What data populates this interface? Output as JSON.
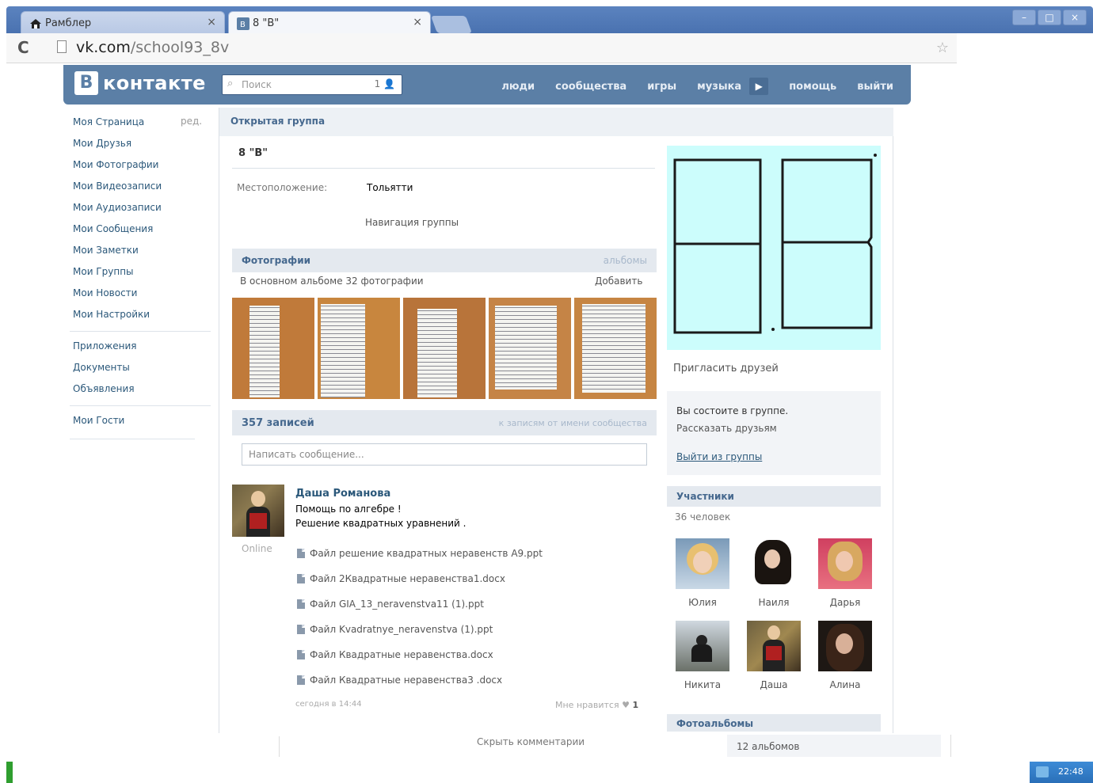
{
  "browser": {
    "tabs": [
      {
        "label": "Рамблер",
        "close": "×"
      },
      {
        "label": "8 \"В\"",
        "close": "×"
      }
    ],
    "window_controls": [
      "–",
      "□",
      "×"
    ],
    "url_host": "vk.com",
    "url_path": "/school93_8v"
  },
  "vk": {
    "logo_letter": "В",
    "logo_text": "контакте",
    "search_placeholder": "Поиск",
    "search_count": "1",
    "nav": [
      "люди",
      "сообщества",
      "игры",
      "музыка",
      "помощь",
      "выйти"
    ]
  },
  "left_menu": {
    "edit_label": "ред.",
    "items": [
      "Моя Страница",
      "Мои Друзья",
      "Мои Фотографии",
      "Мои Видеозаписи",
      "Мои Аудиозаписи",
      "Мои Сообщения",
      "Мои Заметки",
      "Мои Группы",
      "Мои Новости",
      "Мои Настройки"
    ],
    "items2": [
      "Приложения",
      "Документы",
      "Объявления"
    ],
    "items3": [
      "Мои Гости"
    ]
  },
  "group": {
    "type": "Открытая группа",
    "name": "8 \"В\"",
    "location_label": "Местоположение:",
    "location_value": "Тольятти",
    "navigation_link": "Навигация группы"
  },
  "photos": {
    "title": "Фотографии",
    "albums_link": "альбомы",
    "subtitle": "В основном альбоме 32 фотографии",
    "add_link": "Добавить"
  },
  "posts": {
    "count_label": "357 записей",
    "filter_link": "к записям от имени сообщества",
    "compose_placeholder": "Написать сообщение..."
  },
  "post": {
    "author": "Даша Романова",
    "online": "Online",
    "line1": "Помощь по алгебре !",
    "line2": "Решение квадратных уравнений .",
    "files": [
      "Файл решение квадратных неравенств А9.ppt",
      "Файл 2Квадратные неравенства1.docx",
      "Файл GIA_13_neravenstva11 (1).ppt",
      "Файл Kvadratnye_neravenstva (1).ppt",
      "Файл Квадратные неравенства.docx",
      "Файл Квадратные неравенства3 .docx"
    ],
    "date": "сегодня в 14:44",
    "like_label": "Мне нравится",
    "like_count": "1",
    "hide_comments": "Скрыть комментарии"
  },
  "sidebar": {
    "invite": "Пригласить друзей",
    "member_status": "Вы состоите в группе.",
    "tell_friends": "Рассказать друзьям",
    "leave_group": "Выйти из группы",
    "participants_title": "Участники",
    "participants_count": "36 человек",
    "members": [
      {
        "name": "Юлия"
      },
      {
        "name": "Наиля"
      },
      {
        "name": "Дарья"
      },
      {
        "name": "Никита"
      },
      {
        "name": "Даша"
      },
      {
        "name": "Алина"
      }
    ],
    "albums_title": "Фотоальбомы",
    "albums_count": "12 альбомов"
  },
  "taskbar": {
    "time": "22:48"
  },
  "colors": {
    "vk_header": "#5b7fa6",
    "vk_link": "#2b587a",
    "cover_bg": "#ccfdfc"
  }
}
